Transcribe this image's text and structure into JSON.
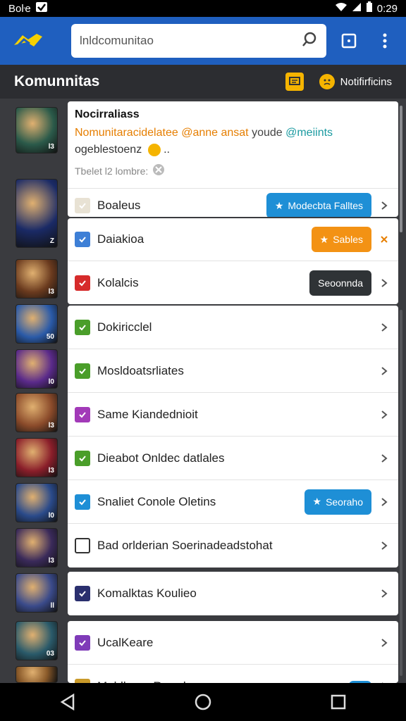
{
  "status_bar": {
    "left_text": "Boŀe",
    "time": "0:29"
  },
  "search": {
    "value": "lnldcomunitao"
  },
  "subheader": {
    "title": "Komunnitas",
    "notifications_label": "Notifirficins"
  },
  "notice": {
    "title": "Nocirraliass",
    "line1_orange": "Nomunitaracidelatee @anne ansat",
    "line1_gray": " youde ",
    "line1_teal": "@meiints",
    "line2": "ogeblestoenz",
    "meta": "Tbelet l2 lombre:"
  },
  "card1_rows": [
    {
      "label": "Boaleus",
      "pill": "Modecbta Falltes",
      "pill_color": "#1e8fd6",
      "icon_color": "#e8e2d4"
    }
  ],
  "card2_rows": [
    {
      "label": "Daiakioa",
      "pill": "Sables",
      "pill_color": "#f39214",
      "icon_color": "#3d7fd6",
      "trailing": "x"
    },
    {
      "label": "Kolalcis",
      "pill": "Seoonnda",
      "pill_color": "#2f3336",
      "icon_color": "#d62b2b"
    }
  ],
  "card3_rows": [
    {
      "label": "Dokiricclel",
      "icon_color": "#4a9e2a"
    },
    {
      "label": "Mosldoatsrliates",
      "icon_color": "#4a9e2a"
    },
    {
      "label": "Same Kiandednioit",
      "icon_color": "#a23ab8"
    },
    {
      "label": "Dieabot Onldec datlales",
      "icon_color": "#4a9e2a"
    },
    {
      "label": "Snaliet Conole Oletins",
      "pill": "Seoraho",
      "pill_color": "#1e8fd6",
      "icon_color": "#1e8fd6"
    },
    {
      "label": "Bad orlderian Soerinadeadstohat",
      "icon_color": "#ffffff"
    }
  ],
  "card4_rows": [
    {
      "label": "Komalktas Koulieo",
      "icon_color": "#2a2f6e"
    }
  ],
  "card5_rows": [
    {
      "label": "UcalKeare",
      "icon_color": "#7f3bb8"
    },
    {
      "label": "Moldlanor Rerode",
      "pill": "",
      "pill_color": "#1e8fd6",
      "icon_color": "#c99a2a"
    }
  ],
  "avatars": [
    {
      "badge": "l3",
      "bg": "#2b5a4a"
    },
    {
      "badge": "Z",
      "bg": "#1a2a66"
    },
    {
      "badge": "l3",
      "bg": "#6a3a1e"
    },
    {
      "badge": "50",
      "bg": "#2a5aa8"
    },
    {
      "badge": "l0",
      "bg": "#5a2a8a"
    },
    {
      "badge": "l3",
      "bg": "#8a4a2a"
    },
    {
      "badge": "l3",
      "bg": "#8a1e2a"
    },
    {
      "badge": "l0",
      "bg": "#2a4a8a"
    },
    {
      "badge": "l3",
      "bg": "#3a2a5a"
    },
    {
      "badge": "ll",
      "bg": "#3a4a8a"
    },
    {
      "badge": "03",
      "bg": "#2a5a6a"
    },
    {
      "badge": "",
      "bg": "#8a5a2a"
    }
  ],
  "colors": {
    "appbar": "#1f5fbf",
    "background": "#3a3b3f",
    "accent_orange": "#f39214",
    "accent_blue": "#1e8fd6"
  }
}
